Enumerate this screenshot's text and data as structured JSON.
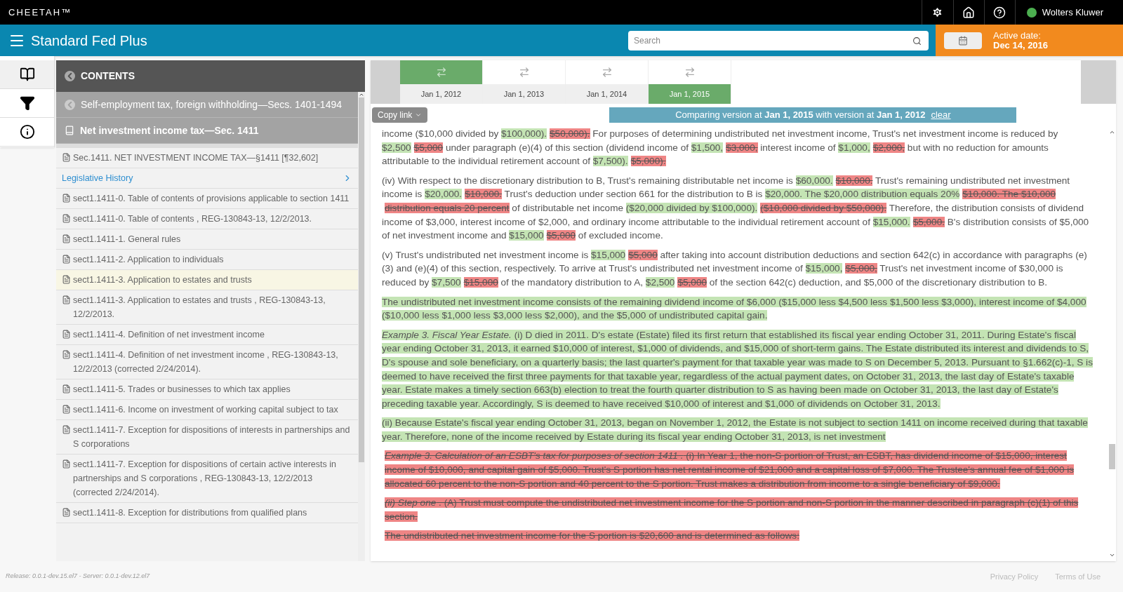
{
  "app_bar": {
    "brand": "CHEETAH™",
    "publisher": "Wolters Kluwer"
  },
  "title_bar": {
    "title": "Standard Fed Plus",
    "search": {
      "placeholder": "Search"
    },
    "active_date_label": "Active date:",
    "active_date": "Dec 14, 2016"
  },
  "rail": [
    {
      "kind": "book",
      "selected": true
    },
    {
      "kind": "filter",
      "selected": false
    },
    {
      "kind": "info",
      "selected": false
    }
  ],
  "contents": {
    "title": "CONTENTS",
    "parents": [
      {
        "kind": "back",
        "text": "Self-employment tax, foreign withholding—Secs. 1401-1494"
      },
      {
        "kind": "book",
        "text": "Net investment income tax—Sec. 1411"
      }
    ],
    "items": [
      {
        "kind": "doc",
        "text": "Sec.1411. NET INVESTMENT INCOME TAX—§1411 [¶32,602]",
        "selected": false
      },
      {
        "kind": "link",
        "text": "Legislative History",
        "selected": false
      },
      {
        "kind": "doc",
        "text": "sect1.1411-0. Table of contents of provisions applicable to section 1411",
        "selected": false
      },
      {
        "kind": "doc",
        "text": "sect1.1411-0. Table of contents , REG-130843-13, 12/2/2013.",
        "selected": false
      },
      {
        "kind": "doc",
        "text": "sect1.1411-1. General rules",
        "selected": false
      },
      {
        "kind": "doc",
        "text": "sect1.1411-2. Application to individuals",
        "selected": false
      },
      {
        "kind": "doc",
        "text": "sect1.1411-3. Application to estates and trusts",
        "selected": true
      },
      {
        "kind": "doc",
        "text": "sect1.1411-3. Application to estates and trusts , REG-130843-13, 12/2/2013.",
        "selected": false
      },
      {
        "kind": "doc",
        "text": "sect1.1411-4. Definition of net investment income",
        "selected": false
      },
      {
        "kind": "doc",
        "text": "sect1.1411-4. Definition of net investment income , REG-130843-13, 12/2/2013 (corrected 2/24/2014).",
        "selected": false
      },
      {
        "kind": "doc",
        "text": "sect1.1411-5. Trades or businesses to which tax applies",
        "selected": false
      },
      {
        "kind": "doc",
        "text": "sect1.1411-6. Income on investment of working capital subject to tax",
        "selected": false
      },
      {
        "kind": "doc",
        "text": "sect1.1411-7. Exception for dispositions of interests in partnerships and S corporations",
        "selected": false
      },
      {
        "kind": "doc",
        "text": "sect1.1411-7. Exception for dispositions of certain active interests in partnerships and S corporations , REG-130843-13, 12/2/2013 (corrected 2/24/2014).",
        "selected": false
      },
      {
        "kind": "doc",
        "text": "sect1.1411-8. Exception for distributions from qualified plans",
        "selected": false
      }
    ]
  },
  "versions": [
    {
      "date": "Jan 1, 2012",
      "compared": true,
      "selected": false
    },
    {
      "date": "Jan 1, 2013",
      "compared": false,
      "selected": false
    },
    {
      "date": "Jan 1, 2014",
      "compared": false,
      "selected": false
    },
    {
      "date": "Jan 1, 2015",
      "compared": false,
      "selected": true
    }
  ],
  "copy_link": "Copy link",
  "compare_banner": {
    "text": "Comparing version at **Jan 1, 2015** with version at **Jan 1, 2012**",
    "clear": "clear"
  },
  "paragraphs": [
    [
      {
        "kind": "same",
        "text": "income ($10,000 divided by "
      },
      {
        "kind": "added",
        "text": "$100,000)."
      },
      {
        "kind": "removed",
        "text": "$50,000)."
      },
      {
        "kind": "same",
        "text": " For purposes of determining undistributed net investment income, Trust's net investment income is reduced by "
      },
      {
        "kind": "added",
        "text": "$2,500"
      },
      {
        "kind": "removed",
        "text": "$5,000"
      },
      {
        "kind": "same",
        "text": " under paragraph (e)(4) of this section (dividend income of "
      },
      {
        "kind": "added",
        "text": "$1,500,"
      },
      {
        "kind": "removed",
        "text": "$3,000,"
      },
      {
        "kind": "same",
        "text": " interest income of "
      },
      {
        "kind": "added",
        "text": "$1,000,"
      },
      {
        "kind": "removed",
        "text": "$2,000,"
      },
      {
        "kind": "same",
        "text": " but with no reduction for amounts attributable to the individual retirement account of "
      },
      {
        "kind": "added",
        "text": "$7,500)."
      },
      {
        "kind": "removed",
        "text": "$5,000)."
      }
    ],
    [
      {
        "kind": "same",
        "text": "(iv) With respect to the discretionary distribution to B, Trust's remaining distributable net income is "
      },
      {
        "kind": "added",
        "text": "$60,000."
      },
      {
        "kind": "removed",
        "text": "$10,000."
      },
      {
        "kind": "same",
        "text": " Trust's remaining undistributed net investment income is "
      },
      {
        "kind": "added",
        "text": "$20,000."
      },
      {
        "kind": "removed",
        "text": "$10,000."
      },
      {
        "kind": "same",
        "text": " Trust's deduction under section 661 for the distribution to B is "
      },
      {
        "kind": "added",
        "text": "$20,000. The $20,000 distribution equals 20%"
      },
      {
        "kind": "removed",
        "text": "$10,000. The $10,000 distribution equals 20 percent"
      },
      {
        "kind": "same",
        "text": " of distributable net income "
      },
      {
        "kind": "added",
        "text": "($20,000 divided by $100,000)."
      },
      {
        "kind": "removed",
        "text": "($10,000 divided by $50,000)."
      },
      {
        "kind": "same",
        "text": " Therefore, the distribution consists of dividend income of $3,000, interest income of $2,000, and ordinary income attributable to the individual retirement account of "
      },
      {
        "kind": "added",
        "text": "$15,000."
      },
      {
        "kind": "removed",
        "text": "$5,000."
      },
      {
        "kind": "same",
        "text": " B's distribution consists of $5,000 of net investment income and "
      },
      {
        "kind": "added",
        "text": "$15,000"
      },
      {
        "kind": "removed",
        "text": "$5,000"
      },
      {
        "kind": "same",
        "text": " of excluded income."
      }
    ],
    [
      {
        "kind": "same",
        "text": "(v) Trust's undistributed net investment income is "
      },
      {
        "kind": "added",
        "text": "$15,000"
      },
      {
        "kind": "removed",
        "text": "$5,000"
      },
      {
        "kind": "same",
        "text": " after taking into account distribution deductions and section 642(c) in accordance with paragraphs (e)(3) and (e)(4) of this section, respectively. To arrive at Trust's undistributed net investment income of "
      },
      {
        "kind": "added",
        "text": "$15,000,"
      },
      {
        "kind": "removed",
        "text": "$5,000,"
      },
      {
        "kind": "same",
        "text": " Trust's net investment income of $30,000 is reduced by "
      },
      {
        "kind": "added",
        "text": "$7,500"
      },
      {
        "kind": "removed",
        "text": "$15,000"
      },
      {
        "kind": "same",
        "text": " of the mandatory distribution to A, "
      },
      {
        "kind": "added",
        "text": "$2,500"
      },
      {
        "kind": "removed",
        "text": "$5,000"
      },
      {
        "kind": "same",
        "text": " of the section 642(c) deduction, and $5,000 of the discretionary distribution to B."
      }
    ],
    [
      {
        "kind": "added",
        "text": "The undistributed net investment income consists of the remaining dividend income of $6,000 ($15,000 less $4,500 less $1,500 less $3,000), interest income of $4,000 ($10,000 less $1,000 less $3,000 less $2,000), and the $5,000 of undistributed capital gain."
      }
    ],
    [
      {
        "kind": "added",
        "text": "*Example 3. Fiscal Year Estate.* (i) D died in 2011. D's estate (Estate) filed its first return that established its fiscal year ending October 31, 2011. During Estate's fiscal year ending October 31, 2013, it earned $10,000 of interest, $1,000 of dividends, and $15,000 of short-term gains. The Estate distributed its interest and dividends to S, D's spouse and sole beneficiary, on a quarterly basis; the last quarter's payment for that taxable year was made to S on December 5, 2013. Pursuant to §1.662(c)-1, S is deemed to have received the first three payments for that taxable year, regardless of the actual payment dates, on October 31, 2013, the last day of Estate's taxable year. Estate makes a timely section 663(b) election to treat the fourth quarter distribution to S as having been made on October 31, 2013, the last day of Estate's preceding taxable year. Accordingly, S is deemed to have received $10,000 of interest and $1,000 of dividends on October 31, 2013."
      }
    ],
    [
      {
        "kind": "added",
        "text": "(ii) Because Estate's fiscal year ending October 31, 2013, began on November 1, 2012, the Estate is not subject to section 1411 on income received during that taxable year. Therefore, none of the income received by Estate during its fiscal year ending October 31, 2013, is net investment"
      }
    ],
    [
      {
        "kind": "removed",
        "text": "*Example 3. Calculation of an ESBT's tax for purposes of section 1411 .* (i) In Year 1, the non-S portion of Trust, an ESBT, has dividend income of $15,000, interest income of $10,000, and capital gain of $5,000. Trust's S portion has net rental income of $21,000 and a capital loss of $7,000. The Trustee's annual fee of $1,000 is allocated 60 percent to the non-S portion and 40 percent to the S portion. Trust makes a distribution from income to a single beneficiary of $9,000."
      }
    ],
    [
      {
        "kind": "removed",
        "text": "*(ii) Step one* . (A) Trust must compute the undistributed net investment income for the S portion and non-S portion in the manner described in paragraph (c)(1) of this section."
      }
    ],
    [
      {
        "kind": "removed",
        "text": "The undistributed net investment income for the S portion is $20,600 and is determined as follows:"
      }
    ]
  ],
  "footer": {
    "release": "Release: 0.0.1-dev.15.el7 - Server: 0.0.1-dev.12.el7",
    "links": [
      "Privacy Policy",
      "Terms of Use"
    ]
  }
}
